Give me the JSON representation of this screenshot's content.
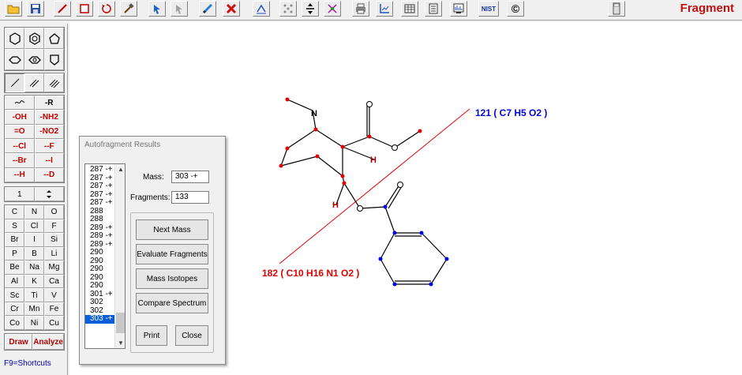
{
  "toolbar": {
    "mode_title": "Fragment",
    "icons": [
      "open-folder",
      "save",
      "draw-bond",
      "erase",
      "rotate",
      "tools",
      "undo-arrow",
      "redo-arrow",
      "pencil",
      "delete-x",
      "center-structure",
      "select-atoms",
      "move-fragment",
      "cleave-bond",
      "printer",
      "chart-axes",
      "table",
      "list",
      "spectrum",
      "nist",
      "copyright",
      "calculator"
    ],
    "nist_label": "NIST",
    "copyright_label": "©"
  },
  "palette": {
    "groups_row1": [
      "-R"
    ],
    "groups": [
      [
        "-OH",
        "-NH2"
      ],
      [
        "=O",
        "-NO2"
      ],
      [
        "--Cl",
        "--F"
      ],
      [
        "--Br",
        "--I"
      ],
      [
        "--H",
        "--D"
      ]
    ],
    "counter_value": "1",
    "elements": [
      [
        "C",
        "N",
        "O"
      ],
      [
        "S",
        "Cl",
        "F"
      ],
      [
        "Br",
        "I",
        "Si"
      ],
      [
        "P",
        "B",
        "Li"
      ],
      [
        "Be",
        "Na",
        "Mg"
      ],
      [
        "Al",
        "K",
        "Ca"
      ],
      [
        "Sc",
        "Ti",
        "V"
      ],
      [
        "Cr",
        "Mn",
        "Fe"
      ],
      [
        "Co",
        "Ni",
        "Cu"
      ]
    ],
    "draw_label": "Draw",
    "analyze_label": "Analyze",
    "shortcuts": "F9=Shortcuts"
  },
  "canvas": {
    "fragment_left": "182 ( C10 H16 N1 O2 )",
    "fragment_right": "121 ( C7 H5 O2 )",
    "atom_labels": [
      "N",
      "H",
      "H",
      "O",
      "O",
      "O",
      "O"
    ],
    "colors": {
      "left_fragment": "#e00000",
      "right_fragment": "#0000e0",
      "cut_line": "#e00000"
    }
  },
  "dialog": {
    "title": "Autofragment Results",
    "masses": [
      "287 -+",
      "287 -+",
      "287 -+",
      "287 -+",
      "287 -+",
      "288",
      "288",
      "289 -+",
      "289 -+",
      "289 -+",
      "290",
      "290",
      "290",
      "290",
      "290",
      "301 -+",
      "302",
      "302",
      "303 -+"
    ],
    "selected_mass": "303 -+",
    "mass_label": "Mass:",
    "mass_value": "303 -+",
    "fragments_label": "Fragments:",
    "fragments_value": "133",
    "buttons": {
      "next_mass": "Next Mass",
      "evaluate": "Evaluate Fragments",
      "isotopes": "Mass Isotopes",
      "compare": "Compare Spectrum",
      "print": "Print",
      "close": "Close"
    }
  }
}
